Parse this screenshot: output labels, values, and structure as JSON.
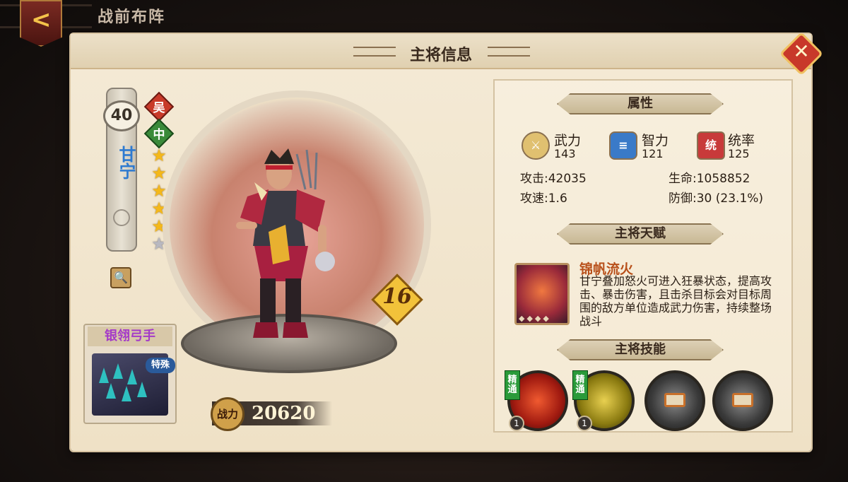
{
  "top_bar": {
    "title": "战前布阵",
    "back_icon": "back-arrow-icon"
  },
  "panel": {
    "title": "主将信息",
    "close_icon": "close-icon"
  },
  "hero": {
    "level": "40",
    "name": "甘宁",
    "faction": "吴",
    "position": "中",
    "stars_filled": 5,
    "stars_total": 6,
    "star_level": "16",
    "power_label": "战力",
    "power": "20620"
  },
  "troop": {
    "name": "银翎弓手",
    "tag": "特殊"
  },
  "attributes": {
    "title": "属性",
    "primary": [
      {
        "name": "武力",
        "value": "143",
        "icon": "crossed-swords-icon"
      },
      {
        "name": "智力",
        "value": "121",
        "icon": "scroll-icon"
      },
      {
        "name": "统率",
        "value": "125",
        "icon": "banner-icon",
        "icon_text": "统"
      }
    ],
    "stats": [
      {
        "label": "攻击:",
        "value": "42035"
      },
      {
        "label": "生命:",
        "value": "1058852"
      },
      {
        "label": "攻速:",
        "value": "1.6"
      },
      {
        "label": "防御:",
        "value": "30 (23.1%)"
      }
    ]
  },
  "talent": {
    "title": "主将天赋",
    "name": "锦帆流火",
    "description": "甘宁叠加怒火可进入狂暴状态，提高攻击、暴击伤害，且击杀目标会对目标周围的敌方单位造成武力伤害，持续整场战斗"
  },
  "skills": {
    "title": "主将技能",
    "mastery_label": "精通",
    "items": [
      {
        "level": "1",
        "mastered": true,
        "locked": false
      },
      {
        "level": "1",
        "mastered": true,
        "locked": false
      },
      {
        "locked": true
      },
      {
        "locked": true
      }
    ]
  },
  "colors": {
    "hero_name": "#2e7ad0",
    "talent_name": "#b8501a",
    "troop_name": "#a43ac8",
    "star": "#f4b81a"
  }
}
